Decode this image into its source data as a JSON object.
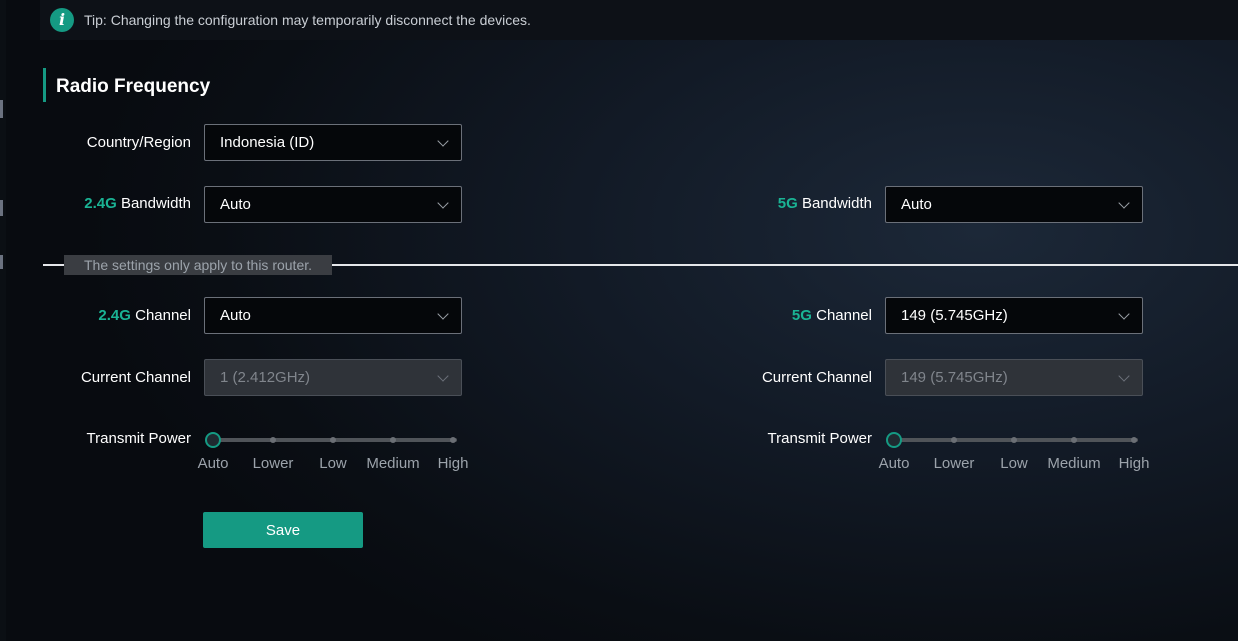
{
  "tip": {
    "text": "Tip: Changing the configuration may temporarily disconnect the devices.",
    "icon": "info-icon"
  },
  "section": {
    "title": "Radio Frequency"
  },
  "country": {
    "label": "Country/Region",
    "value": "Indonesia (ID)"
  },
  "band24": {
    "prefix": "2.4G",
    "bandwidth_label": "Bandwidth",
    "bandwidth_value": "Auto",
    "channel_label": "Channel",
    "channel_value": "Auto",
    "current_label": "Current Channel",
    "current_value": "1  (2.412GHz)",
    "power_label": "Transmit Power",
    "power_level": "Auto"
  },
  "band5": {
    "prefix": "5G",
    "bandwidth_label": "Bandwidth",
    "bandwidth_value": "Auto",
    "channel_label": "Channel",
    "channel_value": "149  (5.745GHz)",
    "current_label": "Current Channel",
    "current_value": "149  (5.745GHz)",
    "power_label": "Transmit Power",
    "power_level": "Auto"
  },
  "power_levels": [
    "Auto",
    "Lower",
    "Low",
    "Medium",
    "High"
  ],
  "divider_note": "The settings only apply to this router.",
  "save_label": "Save",
  "colors": {
    "accent": "#159a83",
    "accent_text": "#1ab394"
  }
}
